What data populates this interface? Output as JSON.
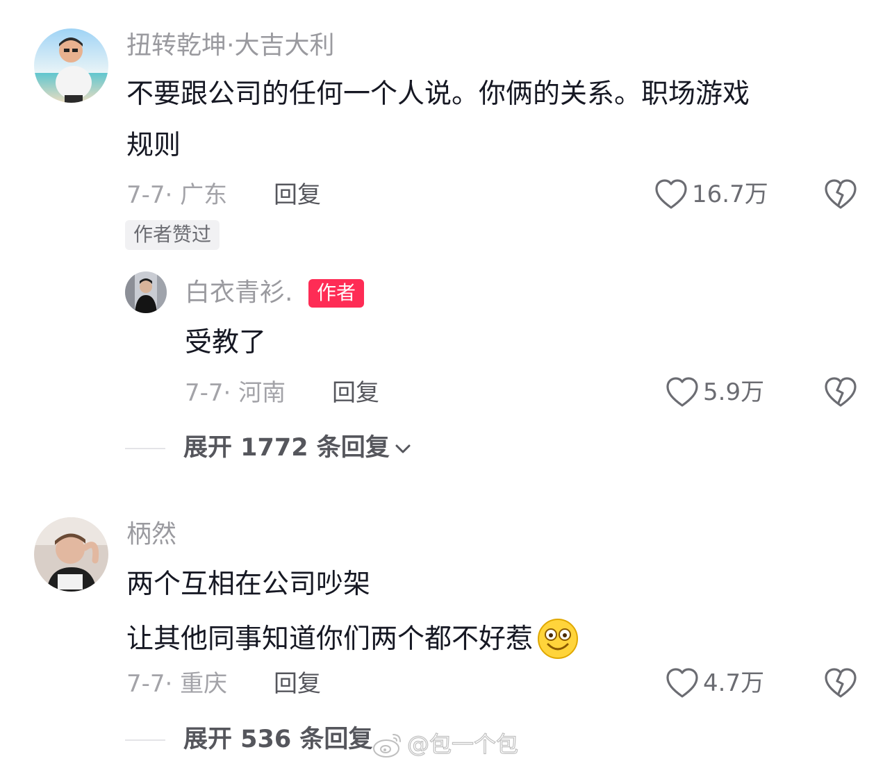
{
  "comments": [
    {
      "username": "扭转乾坤·大吉大利",
      "text_lines": [
        "不要跟公司的任何一个人说。你俩的关系。职场游戏",
        "规则"
      ],
      "meta": "7-7· 广东",
      "reply_label": "回复",
      "likes": "16.7万",
      "liked_by_author_tag": "作者赞过",
      "replies": [
        {
          "username": "白衣青衫.",
          "badge": "作者",
          "text": "受教了",
          "meta": "7-7· 河南",
          "reply_label": "回复",
          "likes": "5.9万"
        }
      ],
      "expand_label": "展开 1772 条回复"
    },
    {
      "username": "柄然",
      "text_lines": [
        "两个互相在公司吵架",
        "让其他同事知道你们两个都不好惹"
      ],
      "text_emoji": "grinning-emoji",
      "meta": "7-7· 重庆",
      "reply_label": "回复",
      "likes": "4.7万",
      "expand_label": "展开 536 条回复"
    }
  ],
  "watermark": {
    "text": "@包一个包",
    "icon": "weibo-logo-icon"
  },
  "colors": {
    "author_badge": "#fe2c55",
    "username": "#9a9a9f",
    "text": "#161823",
    "meta": "#a3a3a8"
  }
}
